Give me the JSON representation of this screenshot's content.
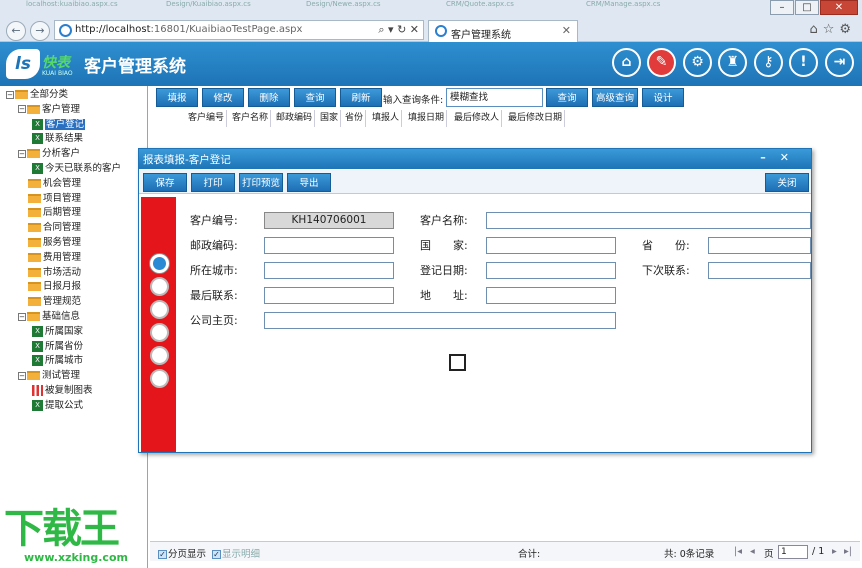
{
  "browser": {
    "ghost_tabs": [
      "localhost:kuaibiao.aspx.cs",
      "Design/Kuaibiao.aspx.cs",
      "Design/Newe.aspx.cs",
      "CRM/Quote.aspx.cs",
      "CRM/Manage.aspx.cs"
    ],
    "url_host": "http://localhost",
    "url_rest": ":16801/KuaibiaoTestPage.aspx",
    "addr_actions": "⌕ ▾ ↻ ✕",
    "tab_title": "客户管理系统",
    "tab_close": "✕",
    "win_min": "–",
    "win_max": "□",
    "win_close": "✕",
    "right_icons": "⌂☆⚙"
  },
  "app": {
    "logo_text": "快表",
    "logo_sub": "KUAI BIAO",
    "title": "客户管理系统",
    "header_icons": [
      "home-icon",
      "form-icon",
      "gear-icon",
      "shirt-icon",
      "key-icon",
      "alert-icon",
      "logout-icon"
    ]
  },
  "tree": [
    {
      "label": "全部分类",
      "type": "folder",
      "level": 0,
      "expander": "−"
    },
    {
      "label": "客户管理",
      "type": "folder",
      "level": 1,
      "expander": "−"
    },
    {
      "label": "客户登记",
      "type": "xls",
      "level": 2,
      "selected": true
    },
    {
      "label": "联系结果",
      "type": "xls",
      "level": 2
    },
    {
      "label": "分析客户",
      "type": "folder",
      "level": 1,
      "expander": "−"
    },
    {
      "label": "今天已联系的客户",
      "type": "xls",
      "level": 2
    },
    {
      "label": "机会管理",
      "type": "folder",
      "level": 1
    },
    {
      "label": "项目管理",
      "type": "folder",
      "level": 1
    },
    {
      "label": "后期管理",
      "type": "folder",
      "level": 1
    },
    {
      "label": "合同管理",
      "type": "folder",
      "level": 1
    },
    {
      "label": "服务管理",
      "type": "folder",
      "level": 1
    },
    {
      "label": "费用管理",
      "type": "folder",
      "level": 1
    },
    {
      "label": "市场活动",
      "type": "folder",
      "level": 1
    },
    {
      "label": "日报月报",
      "type": "folder",
      "level": 1
    },
    {
      "label": "管理规范",
      "type": "folder",
      "level": 1
    },
    {
      "label": "基础信息",
      "type": "folder",
      "level": 1,
      "expander": "−"
    },
    {
      "label": "所属国家",
      "type": "xls",
      "level": 2
    },
    {
      "label": "所属省份",
      "type": "xls",
      "level": 2
    },
    {
      "label": "所属城市",
      "type": "xls",
      "level": 2
    },
    {
      "label": "测试管理",
      "type": "folder",
      "level": 1,
      "expander": "−"
    },
    {
      "label": "被复制图表",
      "type": "chart",
      "level": 2
    },
    {
      "label": "提取公式",
      "type": "xls",
      "level": 2
    }
  ],
  "toolbar": {
    "buttons": [
      "填报",
      "修改",
      "删除",
      "查询",
      "刷新"
    ],
    "query_label": "输入查询条件:",
    "query_value": "模糊查找",
    "buttons_right": [
      "查询",
      "高级查询",
      "设计"
    ]
  },
  "columns": [
    "客户编号",
    "客户名称",
    "邮政编码",
    "国家",
    "省份",
    "填报人",
    "填报日期",
    "最后修改人",
    "最后修改日期"
  ],
  "dialog": {
    "title": "报表填报-客户登记",
    "min": "–",
    "close": "✕",
    "buttons": [
      "保存",
      "打印",
      "打印预览",
      "导出"
    ],
    "close_button": "关闭",
    "fields": {
      "customer_no_label": "客户编号:",
      "customer_no_value": "KH140706001",
      "customer_name_label": "客户名称:",
      "postcode_label": "邮政编码:",
      "country_label": "国　　家:",
      "province_label": "省　　份:",
      "city_label": "所在城市:",
      "reg_date_label": "登记日期:",
      "next_contact_label": "下次联系:",
      "last_contact_label": "最后联系:",
      "address_label": "地　　址:",
      "homepage_label": "公司主页:"
    }
  },
  "status": {
    "paging_label": "分页显示",
    "detail_label": "显示明细",
    "subtotal": "合计:",
    "total": "共: 0条记录",
    "page_label": "页",
    "page_value": "1",
    "page_total": "/ 1"
  },
  "watermark": {
    "big": "下载王",
    "url": "www.xzking.com"
  }
}
